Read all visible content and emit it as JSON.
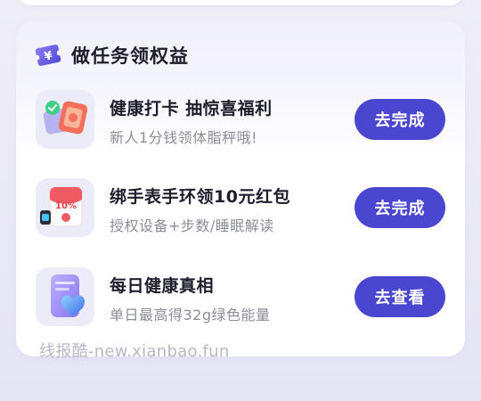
{
  "panel": {
    "title": "做任务领权益",
    "title_icon": "yen-ticket-icon"
  },
  "tasks": [
    {
      "title": "健康打卡 抽惊喜福利",
      "subtitle": "新人1分钱领体脂秤哦!",
      "button": "去完成",
      "icon": "scale-gift-icon"
    },
    {
      "title": "绑手表手环领10元红包",
      "subtitle": "授权设备+步数/睡眠解读",
      "button": "去完成",
      "icon": "watch-red-packet-icon",
      "icon_text": "10%"
    },
    {
      "title": "每日健康真相",
      "subtitle": "单日最高得32g绿色能量",
      "button": "去查看",
      "icon": "phone-heart-icon"
    }
  ],
  "watermark": "线报酷-new.xianbao.fun",
  "colors": {
    "accent": "#4b46cf",
    "title": "#1d1d2c",
    "subtitle": "#8b8c97"
  }
}
